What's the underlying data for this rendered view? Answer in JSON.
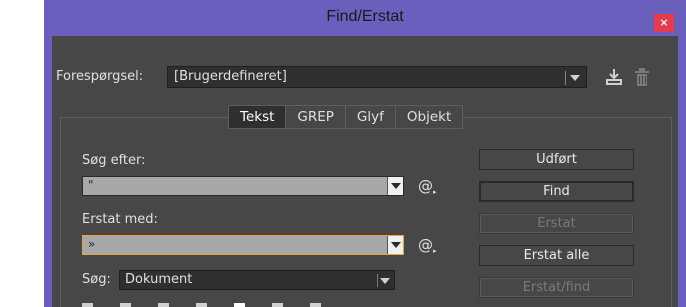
{
  "window": {
    "title": "Find/Erstat",
    "close_glyph": "×"
  },
  "query": {
    "label": "Forespørgsel:",
    "value": "[Brugerdefineret]"
  },
  "icons": {
    "save": "save-query-icon",
    "delete": "trash-icon",
    "dropdown": "chevron-down-icon",
    "special_char": "at-sign-icon"
  },
  "tabs": [
    {
      "label": "Tekst",
      "active": true
    },
    {
      "label": "GREP",
      "active": false
    },
    {
      "label": "Glyf",
      "active": false
    },
    {
      "label": "Objekt",
      "active": false
    }
  ],
  "find": {
    "label": "Søg efter:",
    "value": "\"",
    "special_button": "@"
  },
  "replace": {
    "label": "Erstat med:",
    "value": "»",
    "special_button": "@"
  },
  "search": {
    "label": "Søg:",
    "value": "Dokument"
  },
  "buttons": {
    "done": "Udført",
    "find": "Find",
    "replace": "Erstat",
    "replace_all": "Erstat alle",
    "replace_find": "Erstat/find"
  },
  "colors": {
    "titlebar": "#6b5fbd",
    "panel": "#474747",
    "close": "#e63b4f",
    "focus": "#e8a33a"
  }
}
